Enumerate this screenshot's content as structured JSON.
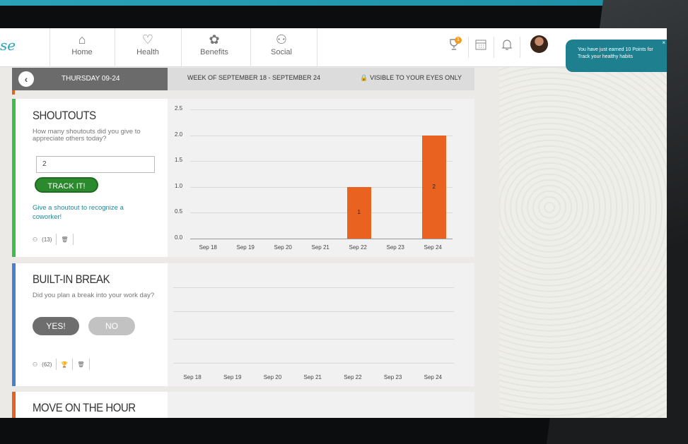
{
  "nav": {
    "logo": "se",
    "items": [
      {
        "label": "Home",
        "icon": "home-icon",
        "glyph": "⌂"
      },
      {
        "label": "Health",
        "icon": "heart-icon",
        "glyph": "♡"
      },
      {
        "label": "Benefits",
        "icon": "benefits-icon",
        "glyph": "✿"
      },
      {
        "label": "Social",
        "icon": "people-icon",
        "glyph": "⚇"
      }
    ],
    "trophy_badge": "1"
  },
  "toast": {
    "text": "You have just earned 10 Points for Track your healthy habits",
    "close": "×"
  },
  "date_bar": {
    "day": "THURSDAY 09-24",
    "week": "WEEK OF SEPTEMBER 18 - SEPTEMBER 24",
    "visibility": "🔒 VISIBLE TO YOUR EYES ONLY"
  },
  "cards": [
    {
      "title": "SHOUTOUTS",
      "question": "How many shoutouts did you give to appreciate others today?",
      "input_value": "2",
      "button": "TRACK IT!",
      "link": "Give a shoutout to recognize a coworker!",
      "participants": "(13)",
      "accent": "#3cbf4a"
    },
    {
      "title": "BUILT-IN BREAK",
      "question": "Did you plan a break into your work day?",
      "yes": "YES!",
      "no": "NO",
      "participants": "(62)",
      "accent": "#4a7fd1"
    },
    {
      "title": "MOVE ON THE HOUR",
      "accent": "#e8621f"
    }
  ],
  "chart_data": [
    {
      "type": "bar",
      "categories": [
        "Sep 18",
        "Sep 19",
        "Sep 20",
        "Sep 21",
        "Sep 22",
        "Sep 23",
        "Sep 24"
      ],
      "values": [
        0,
        0,
        0,
        0,
        1,
        0,
        2
      ],
      "data_labels": [
        "",
        "",
        "",
        "",
        "1",
        "",
        "2"
      ],
      "yticks": [
        "0.0",
        "0.5",
        "1.0",
        "1.5",
        "2.0",
        "2.5"
      ],
      "ylim": [
        0,
        2.5
      ],
      "color": "#e9621f"
    },
    {
      "type": "bar",
      "categories": [
        "Sep 18",
        "Sep 19",
        "Sep 20",
        "Sep 21",
        "Sep 22",
        "Sep 23",
        "Sep 24"
      ],
      "values": []
    }
  ]
}
